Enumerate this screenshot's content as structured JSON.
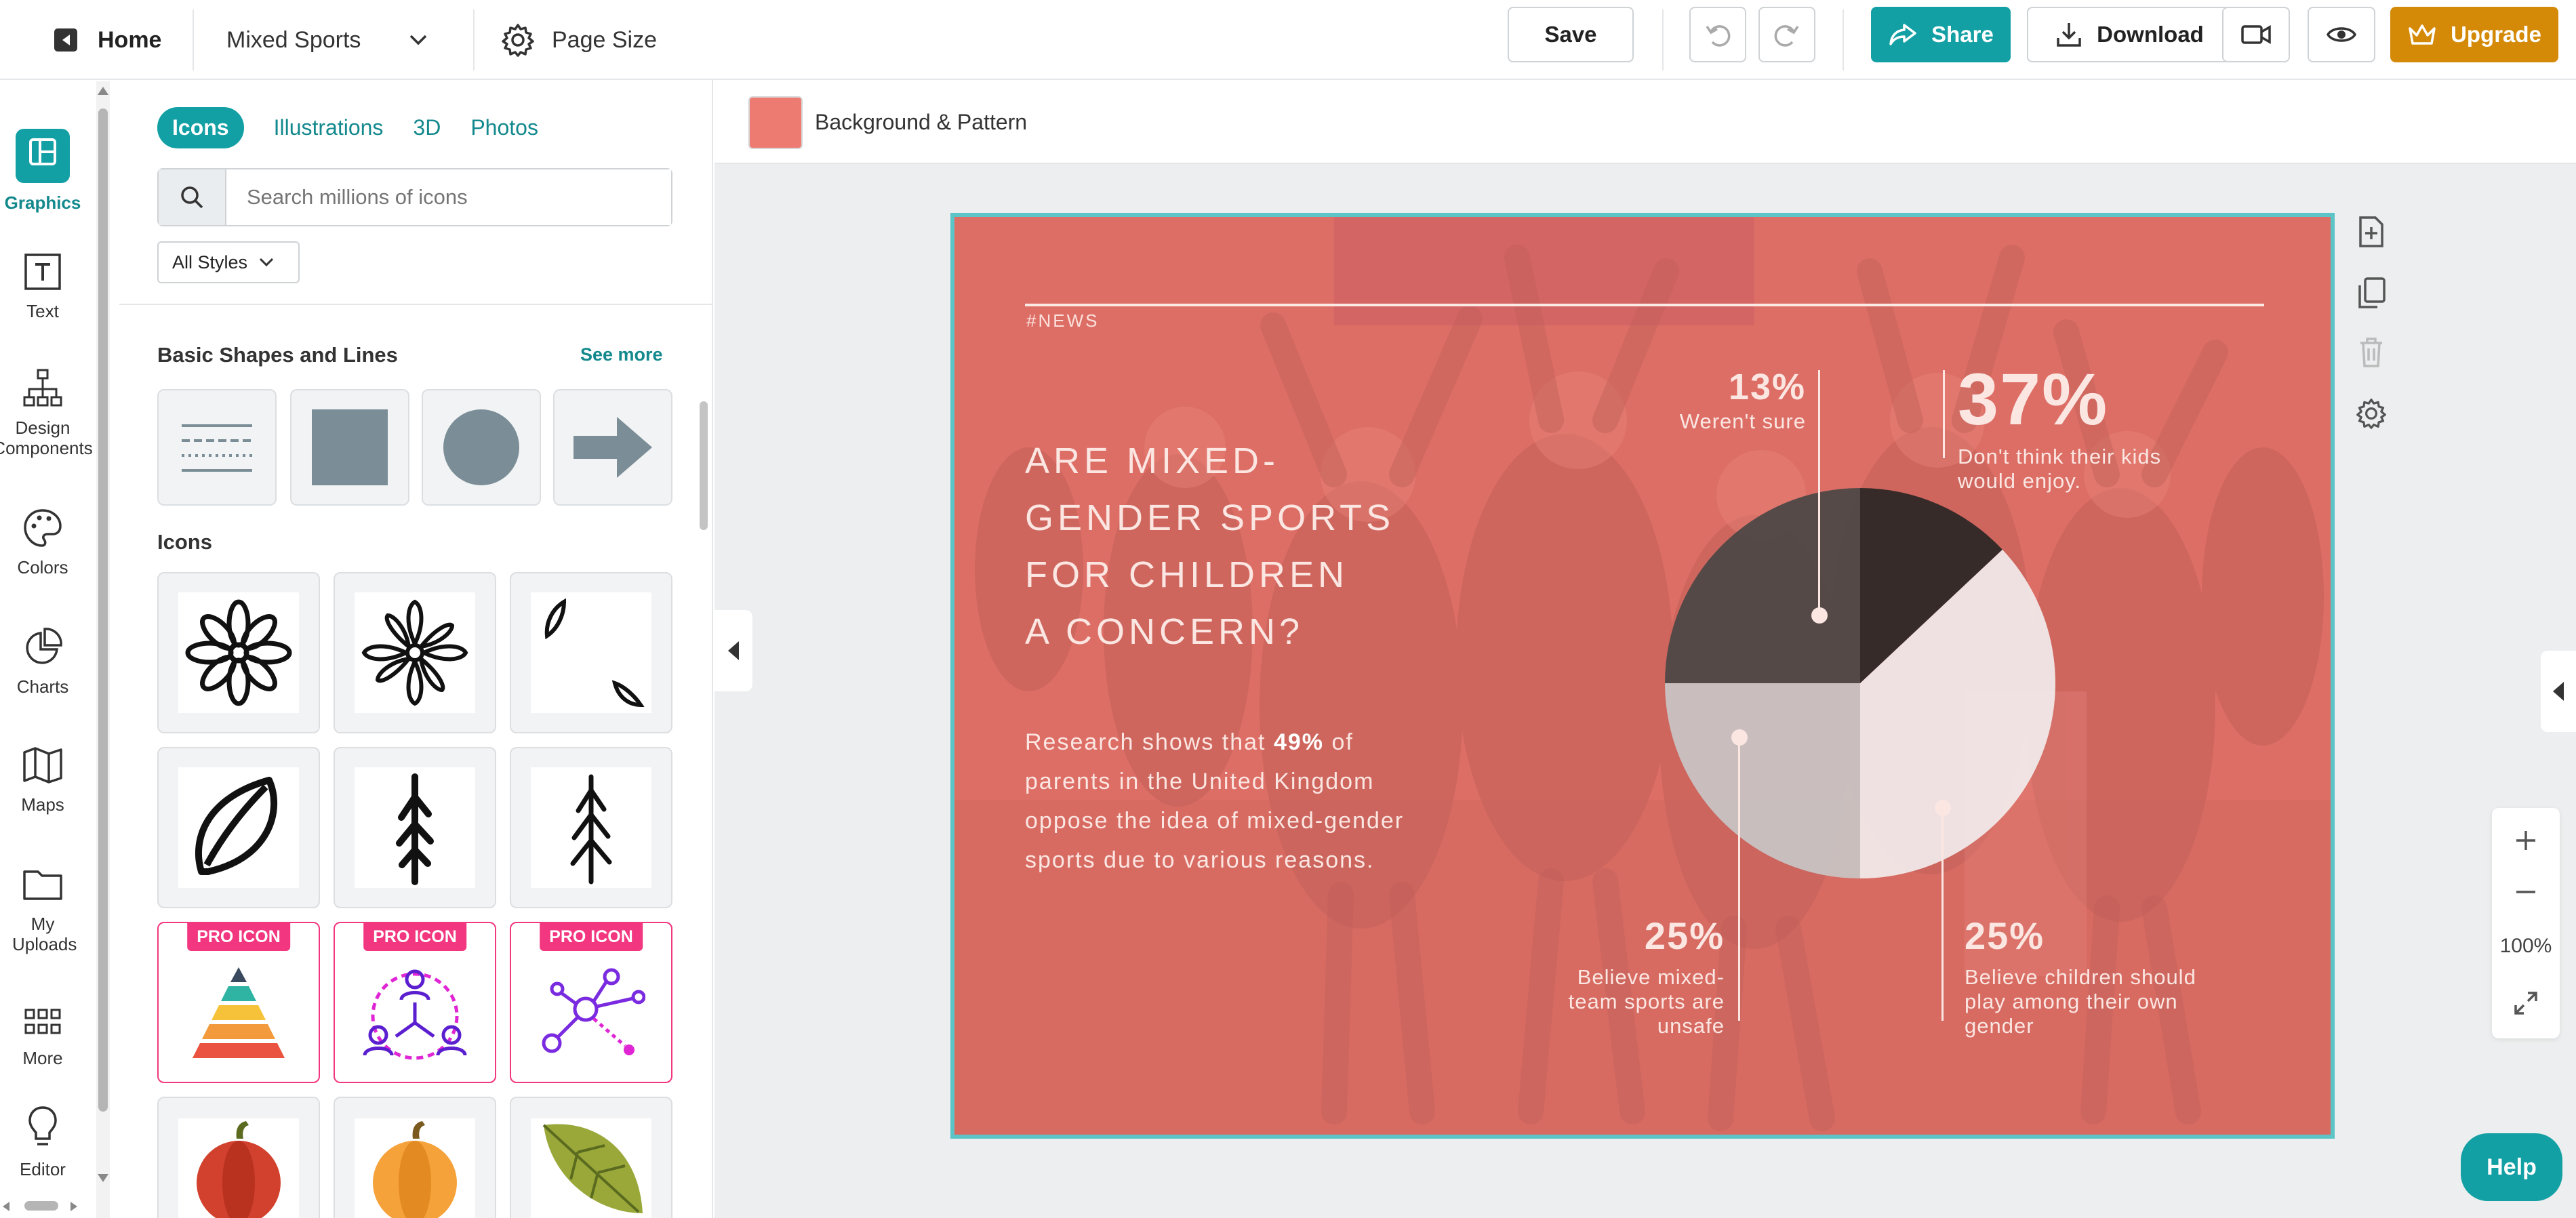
{
  "topbar": {
    "home_label": "Home",
    "doc_name": "Mixed Sports",
    "page_size_label": "Page Size",
    "save_label": "Save",
    "share_label": "Share",
    "download_label": "Download",
    "upgrade_label": "Upgrade"
  },
  "rail": {
    "items": [
      {
        "label": "Graphics",
        "icon": "graphics-icon"
      },
      {
        "label": "Text",
        "icon": "text-icon"
      },
      {
        "label": "Design Components",
        "icon": "design-components-icon"
      },
      {
        "label": "Colors",
        "icon": "palette-icon"
      },
      {
        "label": "Charts",
        "icon": "chart-icon"
      },
      {
        "label": "Maps",
        "icon": "map-icon"
      },
      {
        "label": "My Uploads",
        "icon": "folder-icon"
      },
      {
        "label": "More",
        "icon": "grid-icon"
      },
      {
        "label": "Editor",
        "icon": "lightbulb-icon"
      }
    ]
  },
  "panel": {
    "tabs": [
      "Icons",
      "Illustrations",
      "3D",
      "Photos"
    ],
    "search_placeholder": "Search millions of icons",
    "styles_label": "All Styles",
    "basic_shapes_title": "Basic Shapes and Lines",
    "see_more": "See more",
    "icons_title": "Icons",
    "pro_badge": "PRO ICON"
  },
  "workspace": {
    "bg_label": "Background & Pattern",
    "bg_color": "#ee7b72",
    "accent": "#13a0a4",
    "upgrade_color": "#d48a07",
    "pro_color": "#f2367f"
  },
  "infographic": {
    "tag": "#NEWS",
    "headline": "ARE MIXED-\nGENDER SPORTS\nFOR CHILDREN\n A CONCERN?",
    "research_pre": "Research shows that ",
    "research_bold": "49%",
    "research_post": " of parents in the United Kingdom oppose the idea of mixed-gender sports due to various reasons.",
    "stats": [
      {
        "pct": "13%",
        "label": "Weren't sure"
      },
      {
        "pct": "37%",
        "label": "Don't think their kids would enjoy."
      },
      {
        "pct": "25%",
        "label": "Believe mixed-team sports are unsafe"
      },
      {
        "pct": "25%",
        "label": "Believe children should play among their own gender"
      }
    ]
  },
  "chart_data": {
    "type": "pie",
    "categories": [
      "Weren't sure",
      "Don't think their kids would enjoy.",
      "Believe mixed-team sports are unsafe",
      "Believe children should play among their own gender"
    ],
    "values": [
      13,
      37,
      25,
      25
    ],
    "colors": [
      "#2a2625",
      "#f3f0ef",
      "#c9c6c5",
      "#4a4645"
    ]
  },
  "zoom": {
    "level": "100%"
  },
  "help_label": "Help"
}
